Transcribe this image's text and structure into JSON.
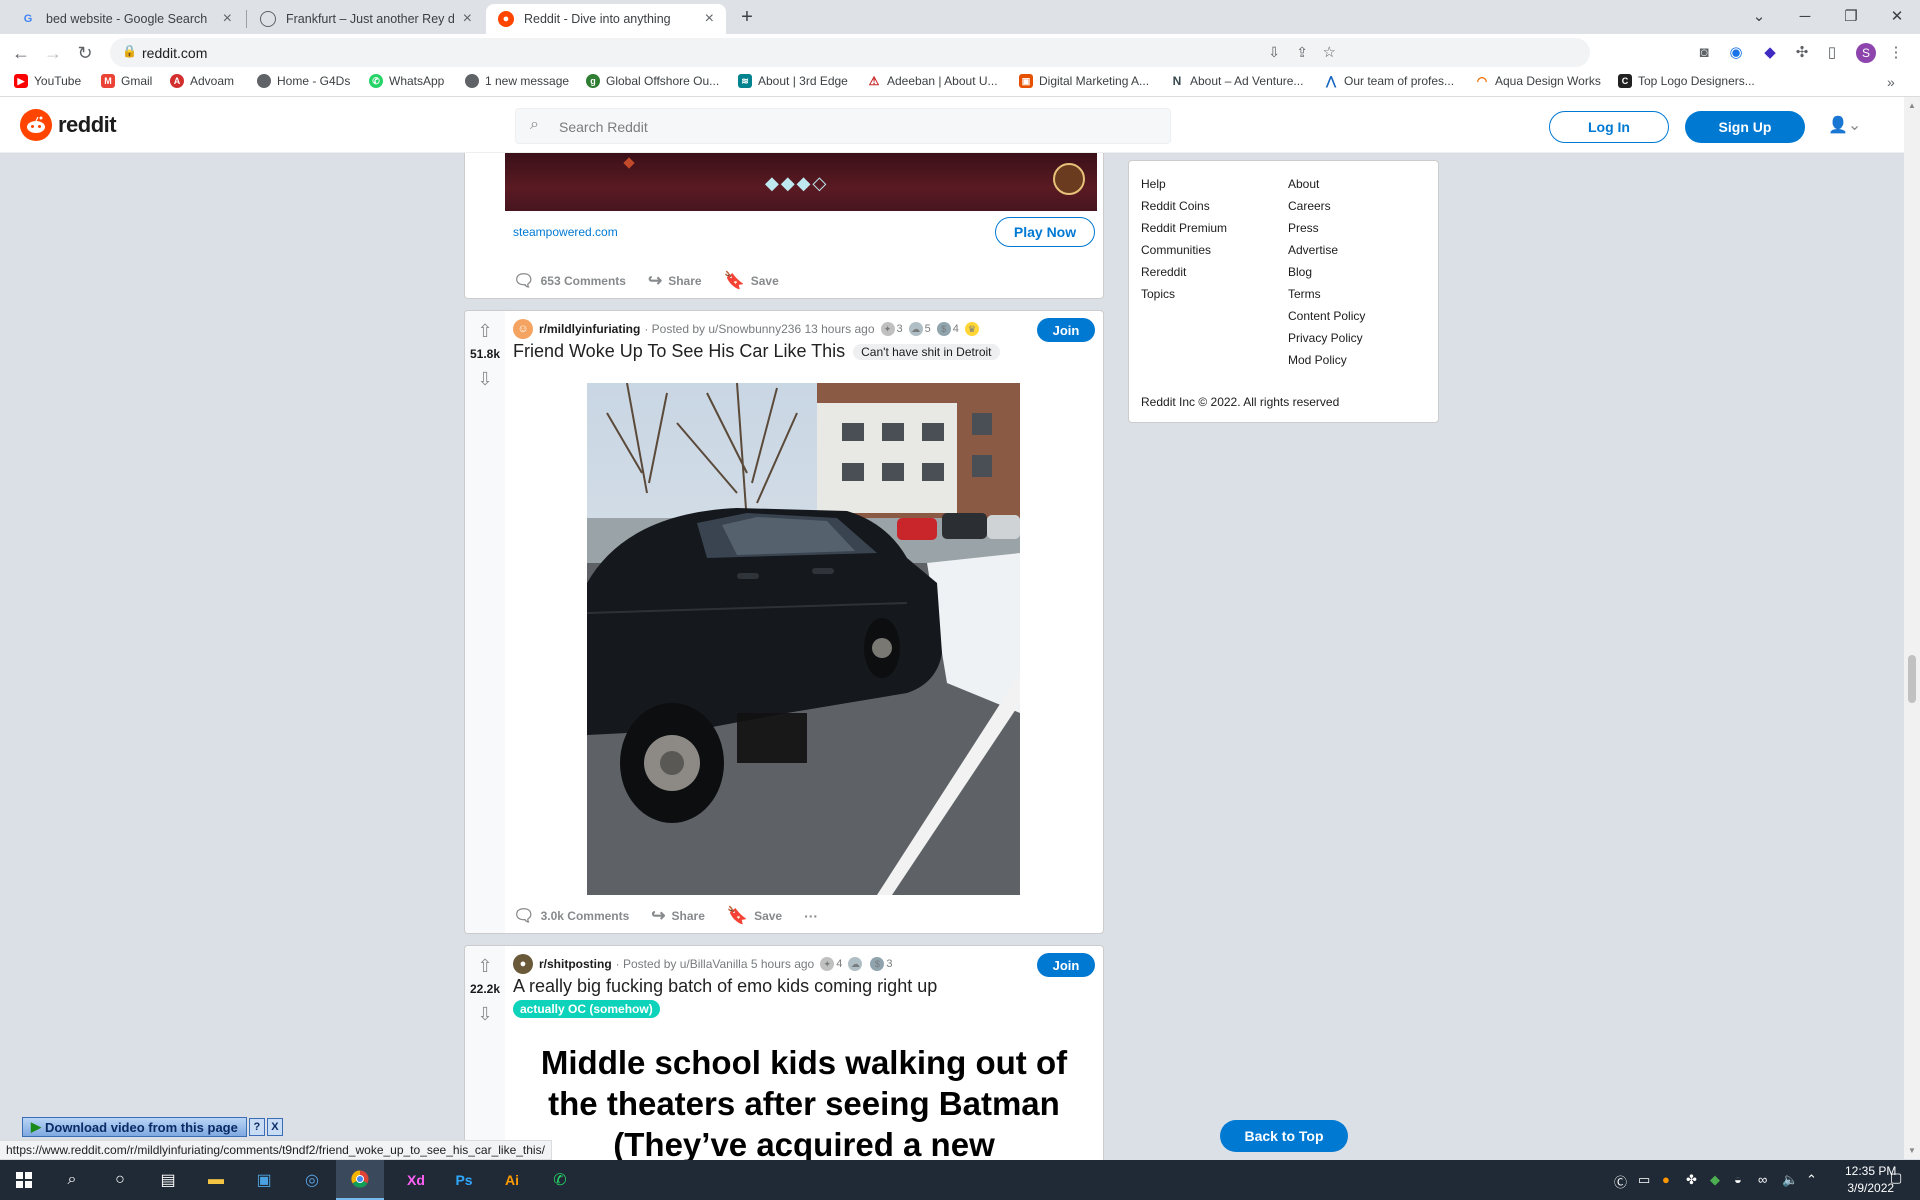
{
  "browser": {
    "tabs": [
      {
        "title": "bed website - Google Search",
        "favicon": "google-icon"
      },
      {
        "title": "Frankfurt – Just another Rey dem",
        "favicon": "globe-icon"
      },
      {
        "title": "Reddit - Dive into anything",
        "favicon": "reddit-icon",
        "active": true
      }
    ],
    "url": "reddit.com",
    "bookmarks": [
      {
        "label": "YouTube",
        "icon": "youtube-icon",
        "color": "#ff0000"
      },
      {
        "label": "Gmail",
        "icon": "gmail-icon",
        "color": "#ea4335"
      },
      {
        "label": "Advoam",
        "icon": "advoam-icon",
        "color": "#d32f2f"
      },
      {
        "label": "Home - G4Ds",
        "icon": "globe-icon",
        "color": "#5f6368"
      },
      {
        "label": "WhatsApp",
        "icon": "whatsapp-icon",
        "color": "#25d366"
      },
      {
        "label": "1 new message",
        "icon": "globe-icon",
        "color": "#5f6368"
      },
      {
        "label": "Global Offshore Ou...",
        "icon": "global-offshore-icon",
        "color": "#2e7d32"
      },
      {
        "label": "About | 3rd Edge",
        "icon": "3rdedge-icon",
        "color": "#00838f"
      },
      {
        "label": "Adeeban | About U...",
        "icon": "adeeban-icon",
        "color": "#c62828"
      },
      {
        "label": "Digital Marketing A...",
        "icon": "digital-marketing-icon",
        "color": "#e65100"
      },
      {
        "label": "About – Ad Venture...",
        "icon": "adventure-icon",
        "color": "#37474f"
      },
      {
        "label": "Our team of profes...",
        "icon": "ourteam-icon",
        "color": "#1565c0"
      },
      {
        "label": "Aqua Design Works",
        "icon": "aqua-icon",
        "color": "#ef6c00"
      },
      {
        "label": "Top Logo Designers...",
        "icon": "toplogo-icon",
        "color": "#212121"
      }
    ]
  },
  "reddit": {
    "logo_text": "reddit",
    "search_placeholder": "Search Reddit",
    "login_label": "Log In",
    "signup_label": "Sign Up",
    "accent": "#0079d3",
    "brand": "#ff4500"
  },
  "ad_post": {
    "domain": "steampowered.com",
    "cta": "Play Now",
    "comments": "653 Comments",
    "share": "Share",
    "save": "Save"
  },
  "posts": [
    {
      "score": "51.8k",
      "subreddit": "r/mildlyinfuriating",
      "posted_by": "· Posted by u/Snowbunny236 13 hours ago",
      "awards": [
        {
          "count": "3"
        },
        {
          "count": "5"
        },
        {
          "count": "4"
        }
      ],
      "join": "Join",
      "title": "Friend Woke Up To See His Car Like This",
      "flair": "Can't have shit in Detroit",
      "comments": "3.0k Comments",
      "share": "Share",
      "save": "Save",
      "more": "···"
    },
    {
      "score": "22.2k",
      "subreddit": "r/shitposting",
      "posted_by": "· Posted by u/BillaVanilla 5 hours ago",
      "awards": [
        {
          "count": "4"
        },
        {
          "count": ""
        },
        {
          "count": "3"
        }
      ],
      "join": "Join",
      "title": "A really big fucking batch of emo kids coming right up",
      "flair": "actually OC (somehow)",
      "image_text": [
        "Middle school kids walking out of",
        "the theaters after seeing Batman",
        "(They’ve acquired a new"
      ]
    }
  ],
  "footer": {
    "col1": [
      "Help",
      "Reddit Coins",
      "Reddit Premium",
      "Communities",
      "Rereddit",
      "Topics"
    ],
    "col2": [
      "About",
      "Careers",
      "Press",
      "Advertise",
      "Blog",
      "Terms",
      "Content Policy",
      "Privacy Policy",
      "Mod Policy"
    ],
    "copyright": "Reddit Inc © 2022. All rights reserved"
  },
  "back_to_top": "Back to Top",
  "download_bar": {
    "label": "Download video from this page",
    "help": "?",
    "close": "X"
  },
  "status_url": "https://www.reddit.com/r/mildlyinfuriating/comments/t9ndf2/friend_woke_up_to_see_his_car_like_this/",
  "taskbar": {
    "time": "12:35 PM",
    "date": "3/9/2022"
  }
}
